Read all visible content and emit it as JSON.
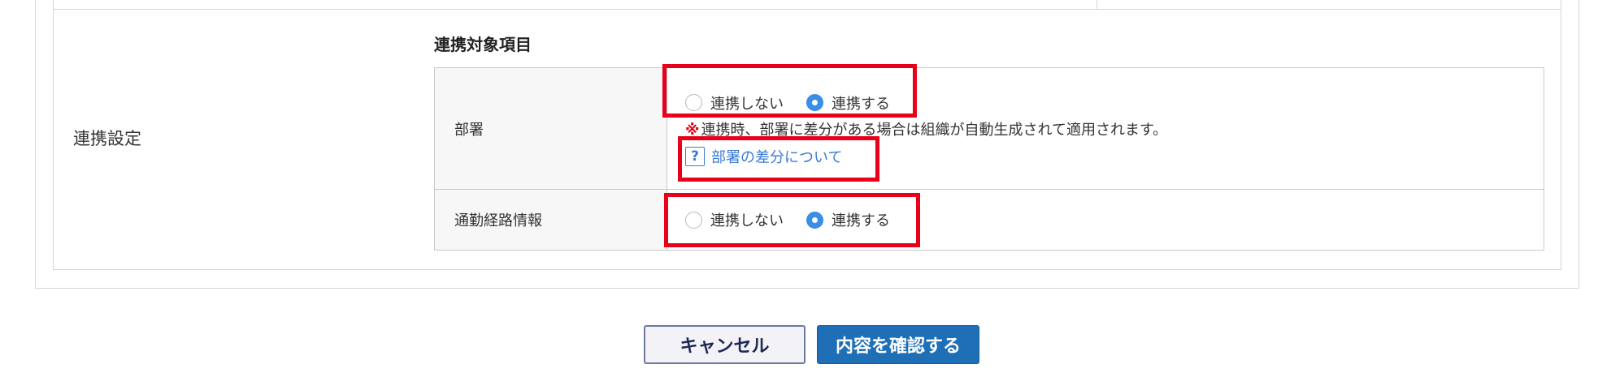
{
  "section": {
    "label": "連携設定",
    "subheading": "連携対象項目"
  },
  "rows": {
    "department": {
      "label": "部署",
      "options": [
        "連携しない",
        "連携する"
      ],
      "selected": "連携する",
      "note_mark": "※",
      "note_text": "連携時、部署に差分がある場合は組織が自動生成されて適用されます。",
      "help_icon": "?",
      "help_link": "部署の差分について"
    },
    "commute": {
      "label": "通勤経路情報",
      "options": [
        "連携しない",
        "連携する"
      ],
      "selected": "連携する"
    }
  },
  "buttons": {
    "cancel": "キャンセル",
    "confirm": "内容を確認する"
  },
  "colors": {
    "highlight": "#e8001a",
    "radio_checked": "#3a8ee6",
    "link": "#3a7bd5",
    "confirm_button": "#1f6fb6"
  }
}
